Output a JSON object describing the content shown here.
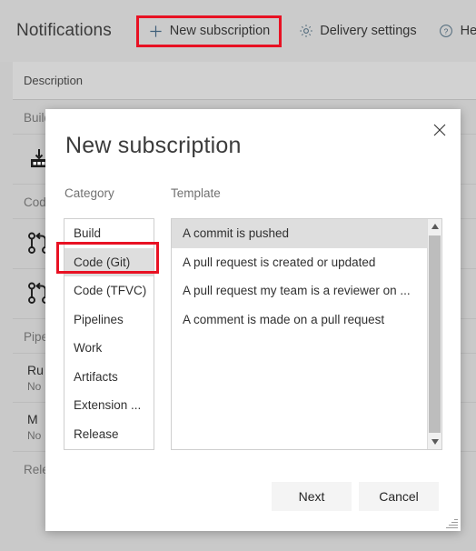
{
  "toolbar": {
    "title": "Notifications",
    "items": [
      {
        "label": "New subscription",
        "icon": "plus-icon",
        "highlighted": true
      },
      {
        "label": "Delivery settings",
        "icon": "gear-icon",
        "highlighted": false
      },
      {
        "label": "Help",
        "icon": "question-circle-icon",
        "highlighted": false
      }
    ]
  },
  "background": {
    "column_header": "Description",
    "groups": [
      {
        "name": "Build",
        "rows": [
          {
            "icon": "build-download-icon",
            "title": "",
            "subtitle": ""
          }
        ]
      },
      {
        "name": "Code",
        "rows": [
          {
            "icon": "pull-request-icon",
            "title": "",
            "subtitle": ""
          },
          {
            "icon": "pull-request-icon",
            "title": "",
            "subtitle": ""
          }
        ]
      },
      {
        "name": "Pipelines",
        "rows": [
          {
            "icon": "",
            "title": "Ru",
            "subtitle": "No"
          },
          {
            "icon": "",
            "title": "M",
            "subtitle": "No"
          }
        ]
      },
      {
        "name": "Release",
        "rows": []
      }
    ]
  },
  "dialog": {
    "title": "New subscription",
    "close_label": "×",
    "category": {
      "header": "Category",
      "items": [
        "Build",
        "Code (Git)",
        "Code (TFVC)",
        "Pipelines",
        "Work",
        "Artifacts",
        "Extension ...",
        "Release"
      ],
      "selected_index": 1,
      "highlighted_index": 1
    },
    "template": {
      "header": "Template",
      "items": [
        "A commit is pushed",
        "A pull request is created or updated",
        "A pull request my team is a reviewer on ...",
        "A comment is made on a pull request"
      ],
      "selected_index": 0,
      "scrollbar": {
        "up_arrow": "▲",
        "down_arrow": "▼"
      }
    },
    "buttons": {
      "next": "Next",
      "cancel": "Cancel"
    }
  },
  "colors": {
    "highlight_red": "#e81123",
    "page_background": "#c9c9c9",
    "dialog_background": "#ffffff",
    "selection_grey": "#dedede",
    "icon_blue": "#40607a"
  }
}
